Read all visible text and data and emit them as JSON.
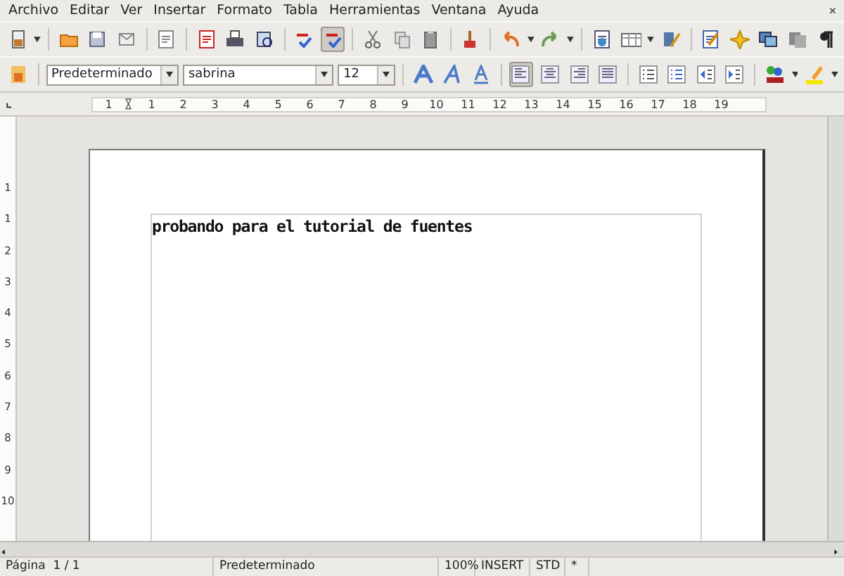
{
  "menu": [
    "Archivo",
    "Editar",
    "Ver",
    "Insertar",
    "Formato",
    "Tabla",
    "Herramientas",
    "Ventana",
    "Ayuda"
  ],
  "standard_toolbar": {
    "autospellcheck": {
      "on": true
    }
  },
  "formatting_toolbar": {
    "paragraph_style": "Predeterminado",
    "font_name": "sabrina",
    "font_size": "12",
    "alignment_buttons": [
      {
        "selected": true
      },
      {
        "selected": false
      },
      {
        "selected": false
      },
      {
        "selected": false
      }
    ]
  },
  "horizontal_ruler": [
    "1",
    "1",
    "2",
    "3",
    "4",
    "5",
    "6",
    "7",
    "8",
    "9",
    "10",
    "11",
    "12",
    "13",
    "14",
    "15",
    "16",
    "17",
    "18",
    "19"
  ],
  "vertical_ruler": [
    "1",
    "1",
    "2",
    "3",
    "4",
    "5",
    "6",
    "7",
    "8",
    "9",
    "10"
  ],
  "document": {
    "text": "probando para el tutorial de fuentes"
  },
  "status_bar": {
    "page": "Página  1 / 1",
    "page_style": "Predeterminado",
    "zoom": "100%",
    "insert_mode": "INSERT",
    "selection_mode": "STD",
    "modified": "*"
  }
}
